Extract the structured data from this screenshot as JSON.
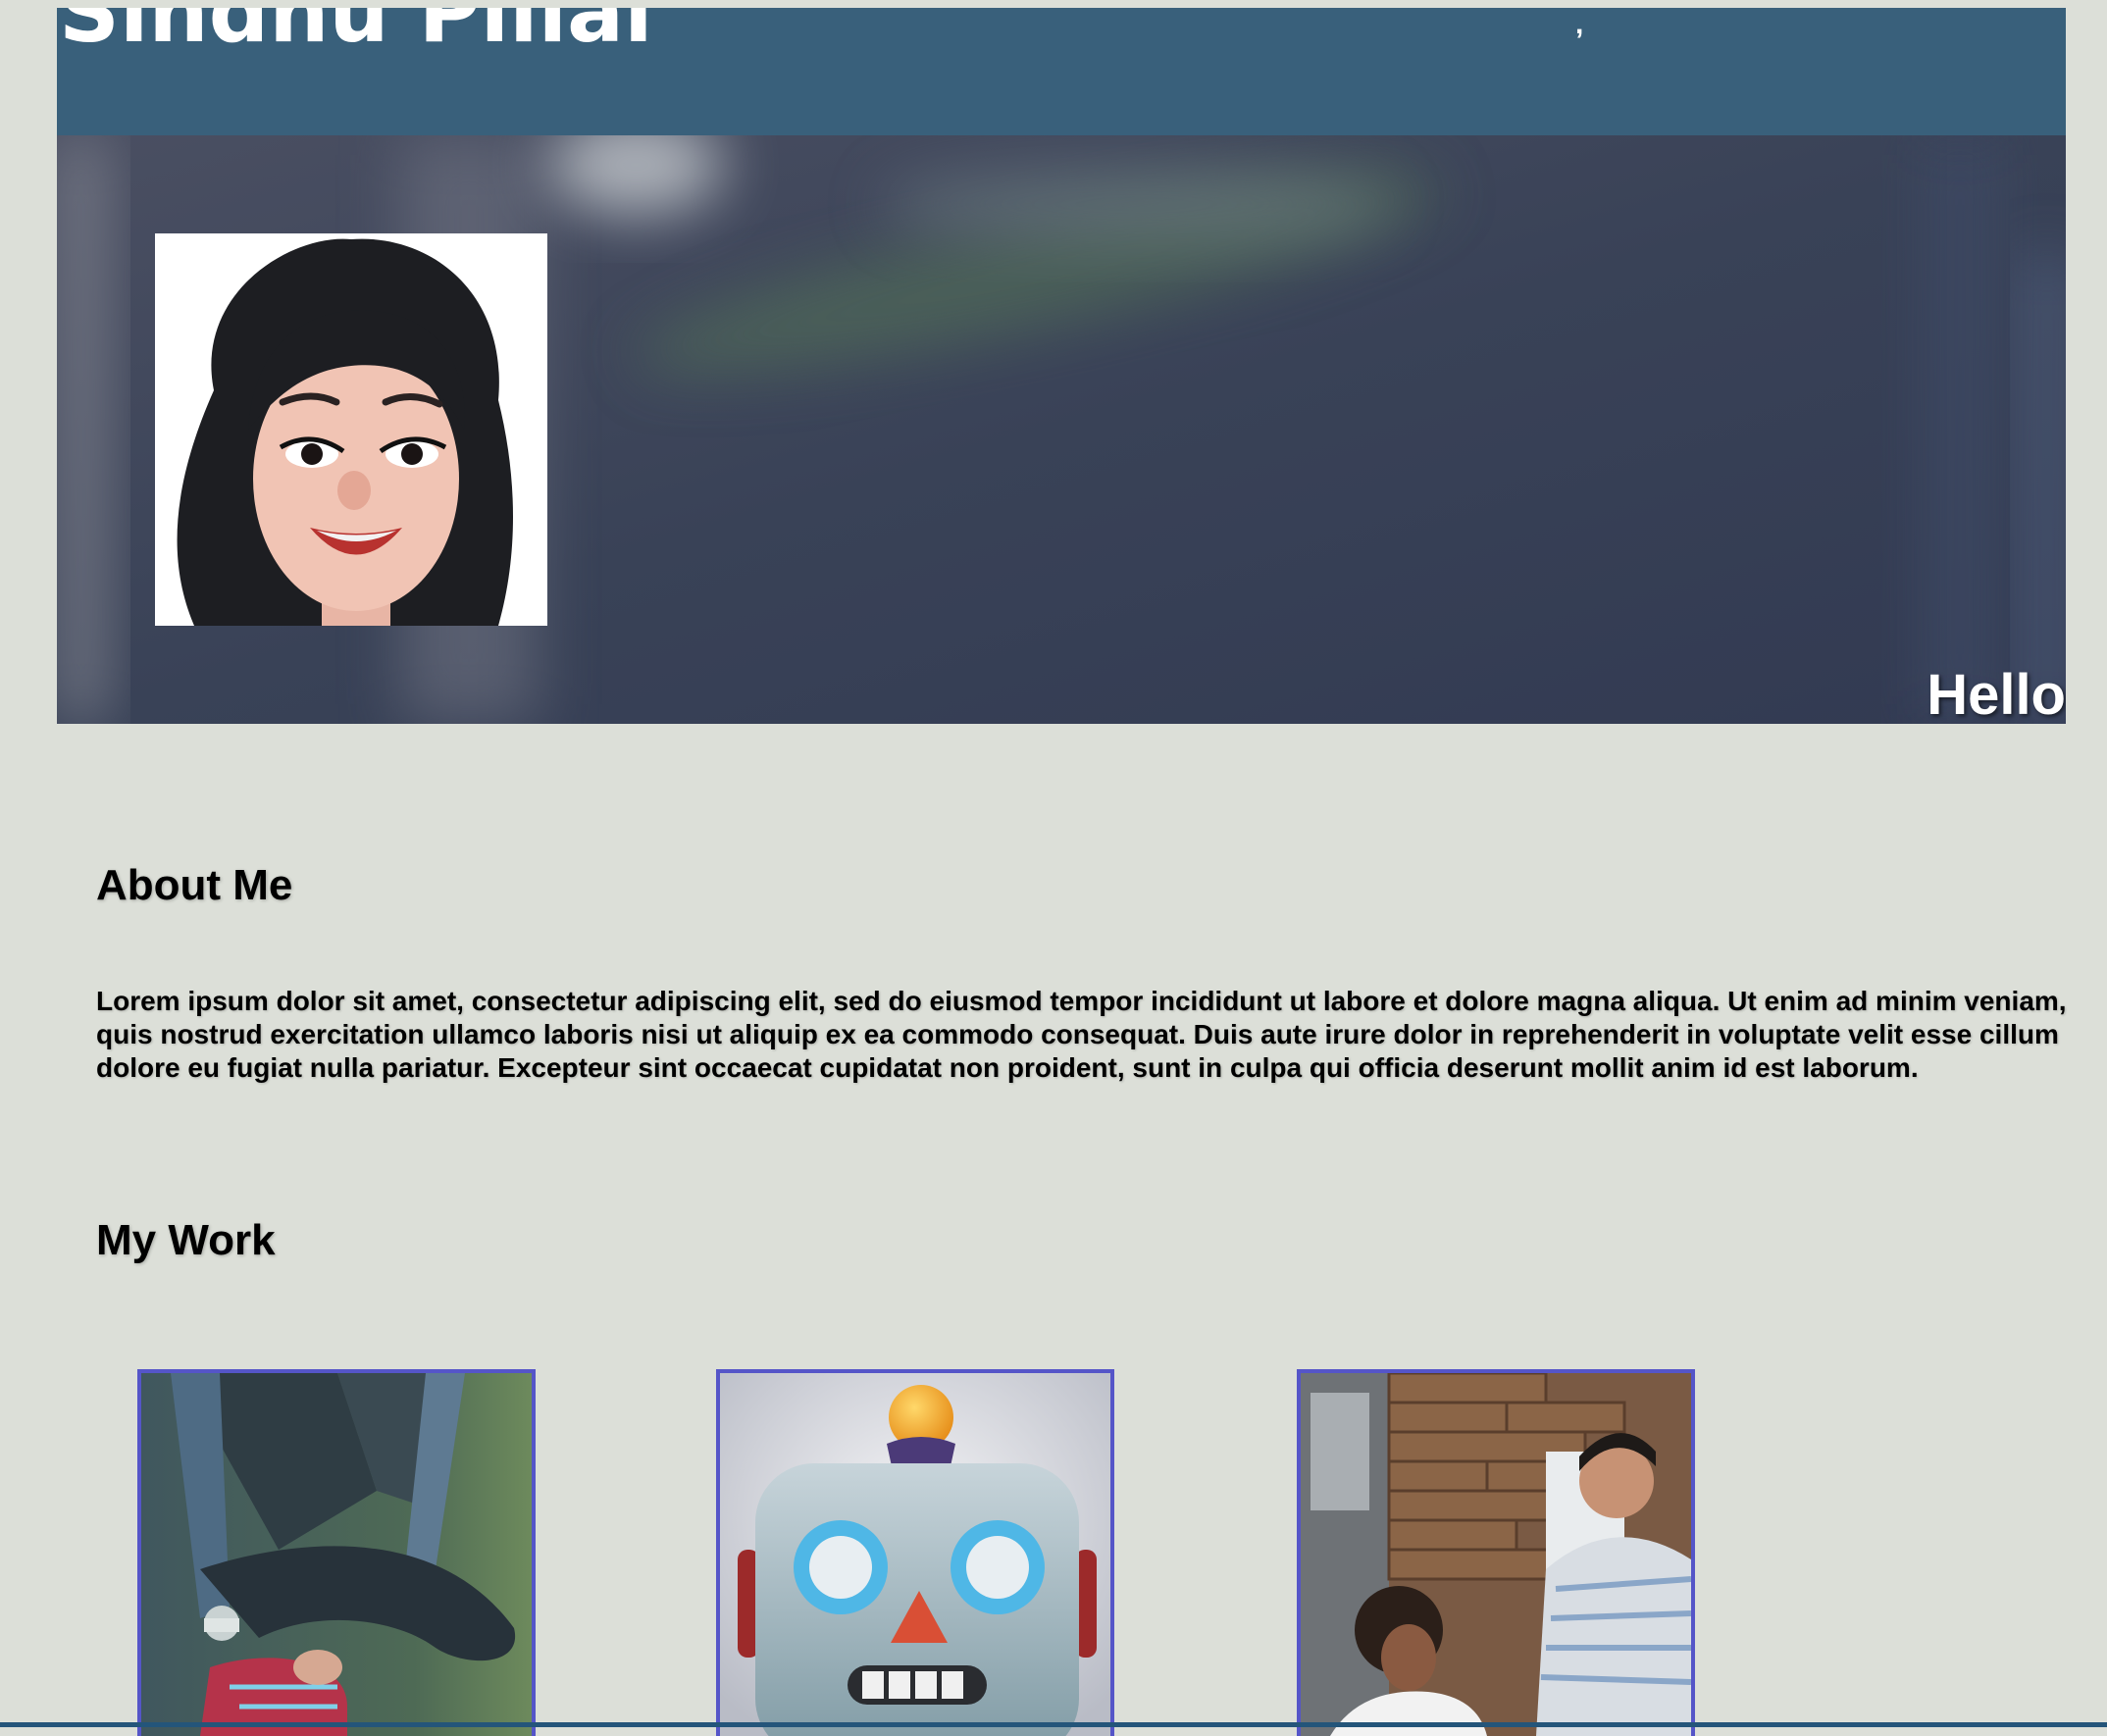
{
  "header": {
    "title": "Sindhu Pillai"
  },
  "hero": {
    "greeting": "Hello"
  },
  "about": {
    "heading": "About Me",
    "body": "Lorem ipsum dolor sit amet, consectetur adipiscing elit, sed do eiusmod tempor incididunt ut labore et dolore magna aliqua. Ut enim ad minim veniam, quis nostrud exercitation ullamco laboris nisi ut aliquip ex ea commodo consequat. Duis aute irure dolor in reprehenderit in voluptate velit esse cillum dolore eu fugiat nulla pariatur. Excepteur sint occaecat cupidatat non proident, sunt in culpa qui officia deserunt mollit anim id est laborum."
  },
  "work": {
    "heading": "My Work",
    "items": [
      {
        "image": "runner-tying-shoe-photo"
      },
      {
        "image": "robot-face-emoji"
      },
      {
        "image": "team-meeting-photo"
      }
    ]
  },
  "colors": {
    "page_background": "#dcdfd8",
    "header_background": "#39607b",
    "card_border": "#5555c8",
    "bottom_rule": "#24557a"
  }
}
